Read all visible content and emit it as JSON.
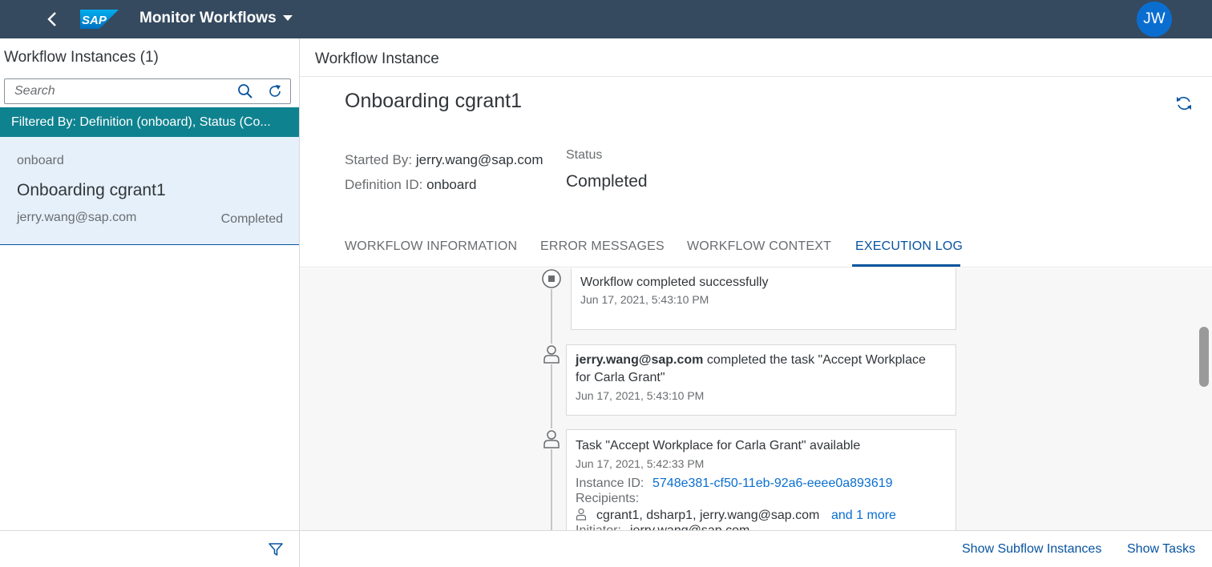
{
  "shell": {
    "logo_text": "SAP",
    "app_title": "Monitor Workflows",
    "avatar_initials": "JW",
    "header_bg": "#354a5f"
  },
  "master": {
    "title": "Workflow Instances (1)",
    "search_placeholder": "Search",
    "filter_text": "Filtered By: Definition (onboard), Status (Co...",
    "items": [
      {
        "definition": "onboard",
        "title": "Onboarding cgrant1",
        "user": "jerry.wang@sap.com",
        "status": "Completed"
      }
    ]
  },
  "detail": {
    "header_title": "Workflow Instance",
    "object_title": "Onboarding cgrant1",
    "started_by_label": "Started By:",
    "started_by_value": "jerry.wang@sap.com",
    "definition_label": "Definition ID:",
    "definition_value": "onboard",
    "status_label": "Status",
    "status_value": "Completed",
    "tabs": [
      {
        "label": "WORKFLOW INFORMATION"
      },
      {
        "label": "ERROR MESSAGES"
      },
      {
        "label": "WORKFLOW CONTEXT"
      },
      {
        "label": "EXECUTION LOG",
        "selected": true
      }
    ],
    "log": [
      {
        "message": "Workflow completed successfully",
        "time": "Jun 17, 2021, 5:43:10 PM",
        "icon": "stop-circle-icon"
      },
      {
        "actor": "jerry.wang@sap.com",
        "message_line1": "completed the task \"Accept Workplace",
        "message_line2": "for Carla Grant\"",
        "time": "Jun 17, 2021, 5:43:10 PM",
        "icon": "person-icon"
      },
      {
        "message": "Task \"Accept Workplace for Carla Grant\" available",
        "time": "Jun 17, 2021, 5:42:33 PM",
        "instance_label": "Instance ID:",
        "instance_id": "5748e381-cf50-11eb-92a6-eeee0a893619",
        "recipients_label": "Recipients:",
        "recipients": "cgrant1, dsharp1, jerry.wang@sap.com",
        "more_link": "and 1 more",
        "initiator_label": "Initiator:",
        "initiator": "jerry.wang@sap.com",
        "icon": "person-icon"
      }
    ],
    "footer": {
      "subflow_button": "Show Subflow Instances",
      "tasks_button": "Show Tasks"
    }
  },
  "colors": {
    "accent": "#0854a0",
    "filter_bar": "#0f828f",
    "selected_item": "#e5f0fa",
    "avatar": "#0a6ed1"
  }
}
